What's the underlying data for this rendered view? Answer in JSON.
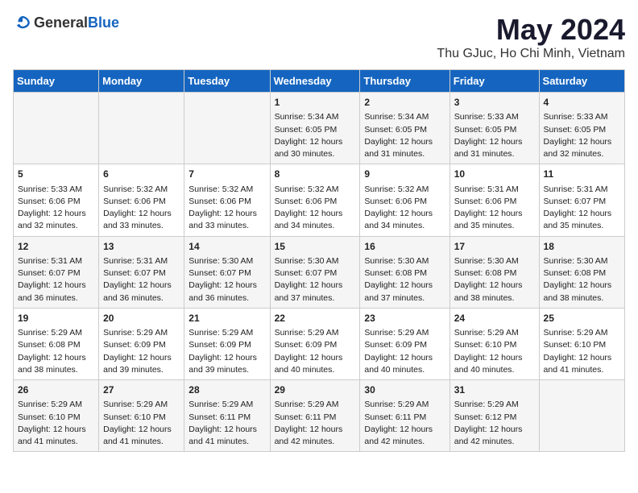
{
  "header": {
    "logo_general": "General",
    "logo_blue": "Blue",
    "month_year": "May 2024",
    "location": "Thu GJuc, Ho Chi Minh, Vietnam"
  },
  "days_of_week": [
    "Sunday",
    "Monday",
    "Tuesday",
    "Wednesday",
    "Thursday",
    "Friday",
    "Saturday"
  ],
  "weeks": [
    [
      {
        "day": "",
        "info": ""
      },
      {
        "day": "",
        "info": ""
      },
      {
        "day": "",
        "info": ""
      },
      {
        "day": "1",
        "info": "Sunrise: 5:34 AM\nSunset: 6:05 PM\nDaylight: 12 hours\nand 30 minutes."
      },
      {
        "day": "2",
        "info": "Sunrise: 5:34 AM\nSunset: 6:05 PM\nDaylight: 12 hours\nand 31 minutes."
      },
      {
        "day": "3",
        "info": "Sunrise: 5:33 AM\nSunset: 6:05 PM\nDaylight: 12 hours\nand 31 minutes."
      },
      {
        "day": "4",
        "info": "Sunrise: 5:33 AM\nSunset: 6:05 PM\nDaylight: 12 hours\nand 32 minutes."
      }
    ],
    [
      {
        "day": "5",
        "info": "Sunrise: 5:33 AM\nSunset: 6:06 PM\nDaylight: 12 hours\nand 32 minutes."
      },
      {
        "day": "6",
        "info": "Sunrise: 5:32 AM\nSunset: 6:06 PM\nDaylight: 12 hours\nand 33 minutes."
      },
      {
        "day": "7",
        "info": "Sunrise: 5:32 AM\nSunset: 6:06 PM\nDaylight: 12 hours\nand 33 minutes."
      },
      {
        "day": "8",
        "info": "Sunrise: 5:32 AM\nSunset: 6:06 PM\nDaylight: 12 hours\nand 34 minutes."
      },
      {
        "day": "9",
        "info": "Sunrise: 5:32 AM\nSunset: 6:06 PM\nDaylight: 12 hours\nand 34 minutes."
      },
      {
        "day": "10",
        "info": "Sunrise: 5:31 AM\nSunset: 6:06 PM\nDaylight: 12 hours\nand 35 minutes."
      },
      {
        "day": "11",
        "info": "Sunrise: 5:31 AM\nSunset: 6:07 PM\nDaylight: 12 hours\nand 35 minutes."
      }
    ],
    [
      {
        "day": "12",
        "info": "Sunrise: 5:31 AM\nSunset: 6:07 PM\nDaylight: 12 hours\nand 36 minutes."
      },
      {
        "day": "13",
        "info": "Sunrise: 5:31 AM\nSunset: 6:07 PM\nDaylight: 12 hours\nand 36 minutes."
      },
      {
        "day": "14",
        "info": "Sunrise: 5:30 AM\nSunset: 6:07 PM\nDaylight: 12 hours\nand 36 minutes."
      },
      {
        "day": "15",
        "info": "Sunrise: 5:30 AM\nSunset: 6:07 PM\nDaylight: 12 hours\nand 37 minutes."
      },
      {
        "day": "16",
        "info": "Sunrise: 5:30 AM\nSunset: 6:08 PM\nDaylight: 12 hours\nand 37 minutes."
      },
      {
        "day": "17",
        "info": "Sunrise: 5:30 AM\nSunset: 6:08 PM\nDaylight: 12 hours\nand 38 minutes."
      },
      {
        "day": "18",
        "info": "Sunrise: 5:30 AM\nSunset: 6:08 PM\nDaylight: 12 hours\nand 38 minutes."
      }
    ],
    [
      {
        "day": "19",
        "info": "Sunrise: 5:29 AM\nSunset: 6:08 PM\nDaylight: 12 hours\nand 38 minutes."
      },
      {
        "day": "20",
        "info": "Sunrise: 5:29 AM\nSunset: 6:09 PM\nDaylight: 12 hours\nand 39 minutes."
      },
      {
        "day": "21",
        "info": "Sunrise: 5:29 AM\nSunset: 6:09 PM\nDaylight: 12 hours\nand 39 minutes."
      },
      {
        "day": "22",
        "info": "Sunrise: 5:29 AM\nSunset: 6:09 PM\nDaylight: 12 hours\nand 40 minutes."
      },
      {
        "day": "23",
        "info": "Sunrise: 5:29 AM\nSunset: 6:09 PM\nDaylight: 12 hours\nand 40 minutes."
      },
      {
        "day": "24",
        "info": "Sunrise: 5:29 AM\nSunset: 6:10 PM\nDaylight: 12 hours\nand 40 minutes."
      },
      {
        "day": "25",
        "info": "Sunrise: 5:29 AM\nSunset: 6:10 PM\nDaylight: 12 hours\nand 41 minutes."
      }
    ],
    [
      {
        "day": "26",
        "info": "Sunrise: 5:29 AM\nSunset: 6:10 PM\nDaylight: 12 hours\nand 41 minutes."
      },
      {
        "day": "27",
        "info": "Sunrise: 5:29 AM\nSunset: 6:10 PM\nDaylight: 12 hours\nand 41 minutes."
      },
      {
        "day": "28",
        "info": "Sunrise: 5:29 AM\nSunset: 6:11 PM\nDaylight: 12 hours\nand 41 minutes."
      },
      {
        "day": "29",
        "info": "Sunrise: 5:29 AM\nSunset: 6:11 PM\nDaylight: 12 hours\nand 42 minutes."
      },
      {
        "day": "30",
        "info": "Sunrise: 5:29 AM\nSunset: 6:11 PM\nDaylight: 12 hours\nand 42 minutes."
      },
      {
        "day": "31",
        "info": "Sunrise: 5:29 AM\nSunset: 6:12 PM\nDaylight: 12 hours\nand 42 minutes."
      },
      {
        "day": "",
        "info": ""
      }
    ]
  ]
}
